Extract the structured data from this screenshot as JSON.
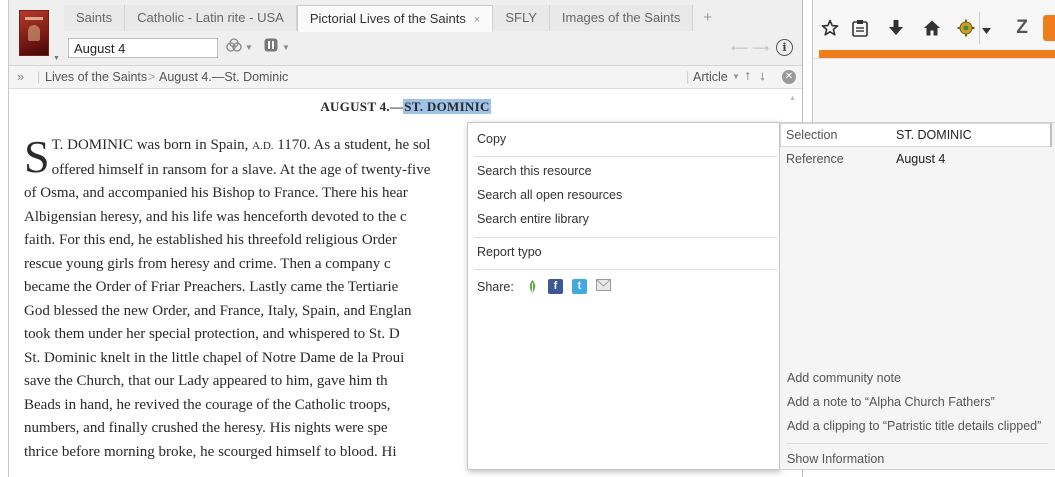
{
  "reader": {
    "tabs": [
      {
        "label": "Saints",
        "active": false
      },
      {
        "label": "Catholic - Latin rite - USA",
        "active": false
      },
      {
        "label": "Pictorial Lives of the Saints",
        "active": true
      },
      {
        "label": "SFLY",
        "active": false
      },
      {
        "label": "Images of the Saints",
        "active": false
      }
    ],
    "tab_add_icon": "+",
    "tab_close_icon": "×",
    "search_value": "August 4",
    "info_icon": "i",
    "breadcrumb": {
      "expand_icon": "»",
      "items": [
        "Lives of the Saints",
        "August 4.—St. Dominic"
      ],
      "separator": ">",
      "view_mode": "Article"
    },
    "page": {
      "heading_prefix": "AUGUST 4.—",
      "heading_selected": "ST. DOMINIC",
      "dropcap": "S",
      "lines": [
        {
          "pre": "T. DOMINIC was born in Spain, ",
          "sc": "A.D.",
          "post": " 1170. As a student, he sol"
        },
        {
          "pre": "offered himself in ransom for a slave. At the age of twenty-five"
        },
        {
          "pre": "of Osma, and accompanied his Bishop to France. There his hear"
        },
        {
          "pre": "Albigensian heresy, and his life was henceforth devoted to the c"
        },
        {
          "pre": "faith. For this end, he established his threefold religious Order"
        },
        {
          "pre": "rescue young girls from heresy and crime. Then a company c"
        },
        {
          "pre": "became the Order of Friar Preachers. Lastly came the Tertiarie"
        },
        {
          "pre": "God blessed the new Order, and France, Italy, Spain, and Englan"
        },
        {
          "pre": "took them under her special protection, and whispered to St. D"
        },
        {
          "pre": "St. Dominic knelt in the little chapel of Notre Dame de la Proui"
        },
        {
          "pre": "save the Church, that our Lady appeared to him, gave him th"
        },
        {
          "pre": "Beads in hand, he revived the courage of the Catholic troops,"
        },
        {
          "pre": "numbers, and finally crushed the heresy. His nights were spe"
        },
        {
          "pre": "thrice before morning broke, he scourged himself to blood. Hi"
        }
      ]
    }
  },
  "context_menu": {
    "copy": "Copy",
    "search_items": [
      "Search this resource",
      "Search all open resources",
      "Search entire library"
    ],
    "report": "Report typo",
    "share_label": "Share:",
    "share_icons": [
      "faithlife-icon",
      "facebook-icon",
      "twitter-icon",
      "email-icon"
    ],
    "info": {
      "selection_label": "Selection",
      "selection_value": "ST. DOMINIC",
      "reference_label": "Reference",
      "reference_value": "August 4"
    },
    "actions": [
      "Add community note",
      "Add a note to “Alpha Church Fathers”",
      "Add a clipping to “Patristic title details clipped”"
    ],
    "show_info": "Show Information"
  },
  "browser_toolbar": {
    "icons": [
      "star-icon",
      "clipboard-icon",
      "download-icon",
      "home-icon",
      "gear-icon",
      "dropdown-icon",
      "zotero-icon"
    ],
    "zotero_glyph": "Z",
    "accent_color": "#f07c1b"
  }
}
